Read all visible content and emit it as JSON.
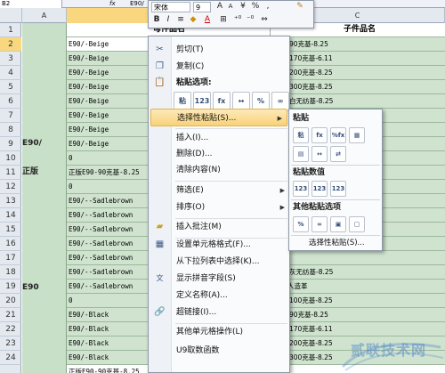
{
  "formula_bar": {
    "name_box": "B2",
    "fx": "fx",
    "value": "E90/"
  },
  "columns": [
    "A",
    "B",
    "C"
  ],
  "rows": [
    "1",
    "2",
    "3",
    "4",
    "5",
    "6",
    "7",
    "8",
    "9",
    "10",
    "11",
    "12",
    "13",
    "14",
    "15",
    "16",
    "17",
    "18",
    "19",
    "20",
    "21",
    "22",
    "23",
    "24"
  ],
  "column_a_labels": [
    {
      "text": "E90/",
      "row": 9
    },
    {
      "text": "正版",
      "row": 11
    },
    {
      "text": "E90",
      "row": 19
    }
  ],
  "header_row": {
    "b": "母件品名",
    "c": "子件品名"
  },
  "cells_b": [
    "E90/-Beige",
    "E90/-Beige",
    "E90/-Beige",
    "E90/-Beige",
    "E90/-Beige",
    "E90/-Beige",
    "E90/-Beige",
    "E90/-Beige",
    "0",
    "正版E90-90克基-8.25",
    "0",
    "E90/--Sadlebrown",
    "E90/--Sadlebrown",
    "E90/--Sadlebrown",
    "E90/--Sadlebrown",
    "E90/--Sadlebrown",
    "E90/--Sadlebrown",
    "E90/--Sadlebrown",
    "0",
    "E90/-Black",
    "E90/-Black",
    "E90/-Black",
    "E90/-Black"
  ],
  "cells_c": [
    "E90-90克基-8.25",
    "E90-170克基-6.11",
    "E90-200克基-8.25",
    "E90-300克基-8.25",
    "E90-白无纺基-8.25",
    "E90-无无纺基-8.25",
    "",
    "",
    "",
    "",
    "",
    "",
    "",
    "",
    "",
    "",
    "E90-灰无纺基-8.25",
    "米色人造革",
    "E90-100克基-8.25",
    "E90-90克基-8.25",
    "E90-170克基-6.11",
    "E90-200克基-8.25",
    "E90-300克基-8.25"
  ],
  "bottom_row": {
    "b": "正版E90-90克基-8.25"
  },
  "mini_toolbar": {
    "font": "宋体",
    "size": "9",
    "bold": "B",
    "italic": "I",
    "percent": "%",
    "comma": ","
  },
  "context_menu": {
    "cut": "剪切(T)",
    "copy": "复制(C)",
    "paste_options_heading": "粘贴选项:",
    "paste_icons": [
      "粘",
      "123",
      "fx",
      "↔",
      "%",
      "∞"
    ],
    "paste_special": "选择性粘贴(S)...",
    "insert": "插入(I)...",
    "delete": "删除(D)...",
    "clear": "清除内容(N)",
    "filter": "筛选(E)",
    "sort": "排序(O)",
    "insert_comment": "插入批注(M)",
    "format_cells": "设置单元格格式(F)...",
    "pick_from_list": "从下拉列表中选择(K)...",
    "phonetic": "显示拼音字段(S)",
    "define_name": "定义名称(A)...",
    "hyperlink": "超链接(I)...",
    "other_ops": "其他单元格操作(L)",
    "u9": "U9取数函数"
  },
  "submenu": {
    "paste_heading": "粘贴",
    "paste_icons": [
      "粘",
      "fx",
      "%fx",
      "▦",
      "▤",
      "↔",
      "⇄"
    ],
    "values_heading": "粘贴数值",
    "value_icons": [
      "123",
      "123",
      "123"
    ],
    "other_heading": "其他粘贴选项",
    "other_icons": [
      "%",
      "∞",
      "▣",
      "▢"
    ],
    "paste_special": "选择性粘贴(S)..."
  },
  "watermark": "贰联技术网",
  "colors": {
    "highlight": "#f8d27a",
    "cell_green": "#cfe3cf",
    "menu_bg": "#fafbfc"
  }
}
